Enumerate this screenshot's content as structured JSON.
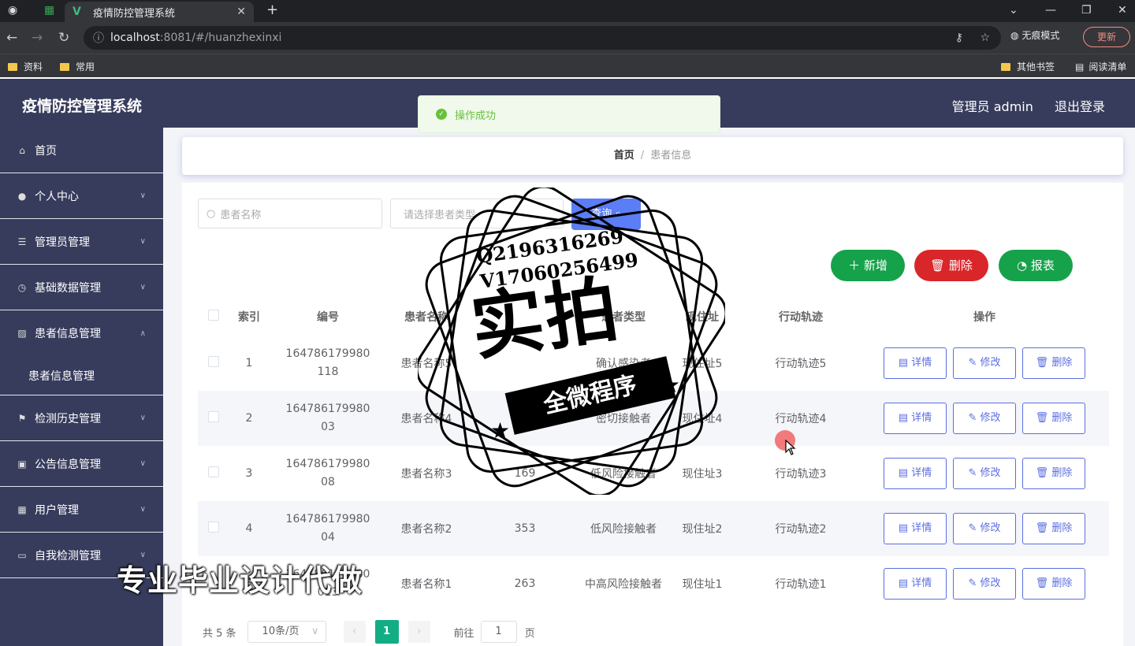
{
  "browser": {
    "tab_title": "疫情防控管理系统",
    "url_host": "localhost",
    "url_rest": ":8081/#/huanzhexinxi",
    "incognito": "无痕模式",
    "update": "更新",
    "bookmarks": [
      "资料",
      "常用"
    ],
    "bookmarks_right": [
      "其他书签",
      "阅读清单"
    ]
  },
  "header": {
    "title": "疫情防控管理系统",
    "user": "管理员 admin",
    "logout": "退出登录"
  },
  "toast": "操作成功",
  "sidebar": {
    "items": [
      {
        "label": "首页"
      },
      {
        "label": "个人中心"
      },
      {
        "label": "管理员管理"
      },
      {
        "label": "基础数据管理"
      },
      {
        "label": "患者信息管理"
      },
      {
        "label": "检测历史管理"
      },
      {
        "label": "公告信息管理"
      },
      {
        "label": "用户管理"
      },
      {
        "label": "自我检测管理"
      }
    ],
    "sub_item": "患者信息管理"
  },
  "breadcrumb": {
    "home": "首页",
    "sep": "/",
    "current": "患者信息"
  },
  "search": {
    "name_placeholder": "患者名称",
    "type_placeholder": "请选择患者类型",
    "query": "查询"
  },
  "actions": {
    "add": "新增",
    "delete": "删除",
    "report": "报表"
  },
  "table": {
    "headers": [
      "索引",
      "编号",
      "患者名称",
      "",
      "患者类型",
      "现住址",
      "行动轨迹",
      "操作"
    ],
    "rows": [
      {
        "idx": "1",
        "no": "164786179980118",
        "name": "患者名称5",
        "num": "",
        "type": "确认感染者",
        "addr": "现住址5",
        "track": "行动轨迹5"
      },
      {
        "idx": "2",
        "no": "16478617998003",
        "name": "患者名称4",
        "num": "",
        "type": "密切接触者",
        "addr": "现住址4",
        "track": "行动轨迹4"
      },
      {
        "idx": "3",
        "no": "16478617998008",
        "name": "患者名称3",
        "num": "169",
        "type": "低风险接触者",
        "addr": "现住址3",
        "track": "行动轨迹3"
      },
      {
        "idx": "4",
        "no": "16478617998004",
        "name": "患者名称2",
        "num": "353",
        "type": "低风险接触者",
        "addr": "现住址2",
        "track": "行动轨迹2"
      },
      {
        "idx": "5",
        "no": "164786179980013",
        "name": "患者名称1",
        "num": "263",
        "type": "中高风险接触者",
        "addr": "现住址1",
        "track": "行动轨迹1"
      }
    ],
    "ops": {
      "detail": "详情",
      "edit": "修改",
      "delete": "删除"
    }
  },
  "pagination": {
    "total": "共 5 条",
    "size": "10条/页",
    "page": "1",
    "goto": "前往",
    "goto_value": "1",
    "page_unit": "页"
  },
  "overlay": {
    "qq": "Q2196316269",
    "vx": "V17060256499",
    "big": "实拍",
    "band": "全微程序",
    "watermark": "专业毕业设计代做"
  }
}
